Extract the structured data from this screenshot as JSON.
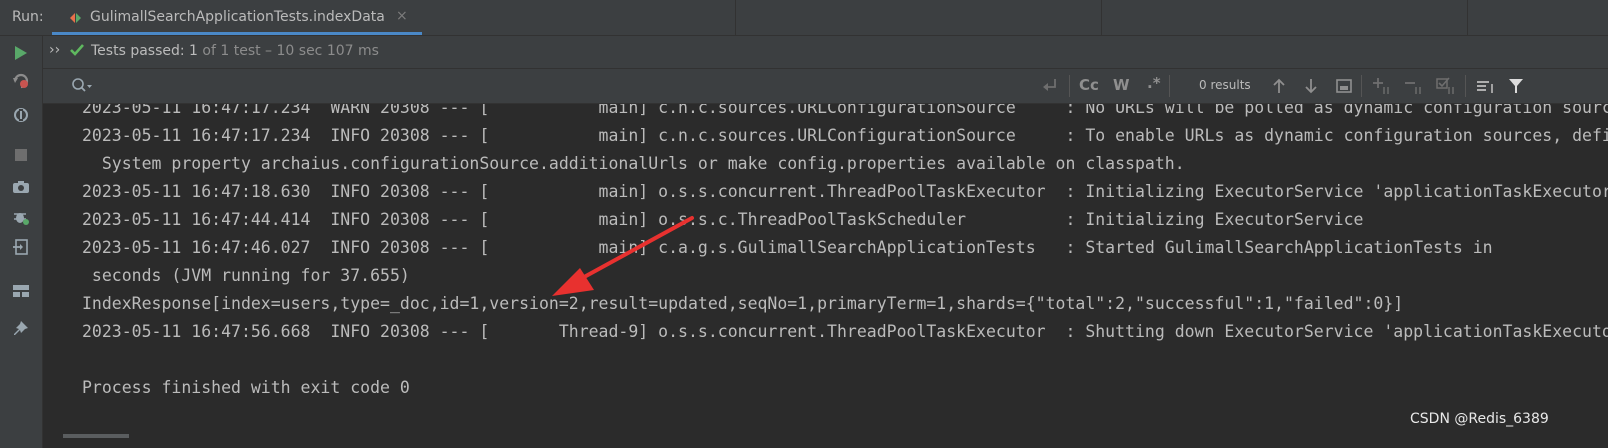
{
  "run_panel": {
    "run_label": "Run:",
    "tab_title": "GulimallSearchApplicationTests.indexData",
    "tab_close": "×",
    "accent_color": "#4a88c7"
  },
  "left_toolbar": {
    "icons": [
      "run-icon",
      "rerun-failed-icon",
      "toggle-auto-test-icon",
      "stop-icon",
      "screenshot-icon",
      "debug-icon",
      "import-icon",
      "layout-icon",
      "pin-icon"
    ]
  },
  "status": {
    "expand_glyph": "››",
    "passed_label": "Tests passed: ",
    "passed_count": "1",
    "detail": " of 1 test – 10 sec 107 ms",
    "pass_color": "#5fb85f"
  },
  "search": {
    "match_case_label": "Cc",
    "words_label": "W",
    "regex_label": ".*",
    "results": "0 results"
  },
  "console_lines": [
    "2023-05-11 16:47:17.234  WARN 20308 --- [           main] c.n.c.sources.URLConfigurationSource     : No URLs will be polled as dynamic configuration sources.",
    "2023-05-11 16:47:17.234  INFO 20308 --- [           main] c.n.c.sources.URLConfigurationSource     : To enable URLs as dynamic configuration sources, define",
    "  System property archaius.configurationSource.additionalUrls or make config.properties available on classpath.",
    "2023-05-11 16:47:18.630  INFO 20308 --- [           main] o.s.s.concurrent.ThreadPoolTaskExecutor  : Initializing ExecutorService 'applicationTaskExecutor'",
    "2023-05-11 16:47:44.414  INFO 20308 --- [           main] o.s.s.c.ThreadPoolTaskScheduler          : Initializing ExecutorService",
    "2023-05-11 16:47:46.027  INFO 20308 --- [           main] c.a.g.s.GulimallSearchApplicationTests   : Started GulimallSearchApplicationTests in",
    " seconds (JVM running for 37.655)",
    "IndexResponse[index=users,type=_doc,id=1,version=2,result=updated,seqNo=1,primaryTerm=1,shards={\"total\":2,\"successful\":1,\"failed\":0}]",
    "2023-05-11 16:47:56.668  INFO 20308 --- [       Thread-9] o.s.s.concurrent.ThreadPoolTaskExecutor  : Shutting down ExecutorService 'applicationTaskExecutor'",
    "",
    "Process finished with exit code 0"
  ],
  "annotation_color": "#e8312f",
  "watermark": "CSDN @Redis_6389"
}
